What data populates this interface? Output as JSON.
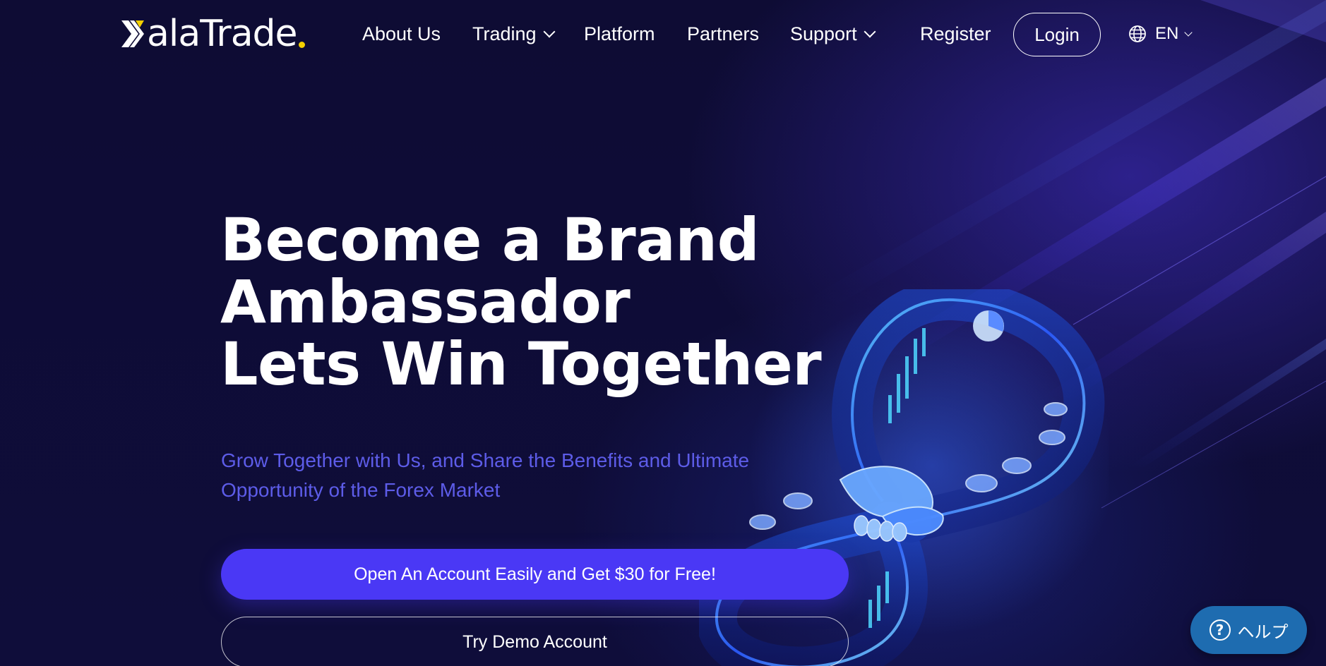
{
  "brand": {
    "name_part1": "ala",
    "name_part2": "Trade",
    "accent_yellow": "#f5d000",
    "primary_purple": "#4a38f5",
    "subtitle_color": "#5d5ce8",
    "background": "#0d0b33"
  },
  "nav": {
    "items": [
      {
        "label": "About Us",
        "has_dropdown": false
      },
      {
        "label": "Trading",
        "has_dropdown": true
      },
      {
        "label": "Platform",
        "has_dropdown": false
      },
      {
        "label": "Partners",
        "has_dropdown": false
      },
      {
        "label": "Support",
        "has_dropdown": true
      }
    ],
    "register_label": "Register",
    "login_label": "Login",
    "language_label": "EN",
    "language_icon": "globe-icon"
  },
  "hero": {
    "title_lines": [
      "Become a Brand",
      "Ambassador",
      "Lets Win Together"
    ],
    "subtitle": "Grow Together with Us, and Share the Benefits and Ultimate Opportunity of the Forex Market",
    "primary_cta": "Open An Account Easily and Get $30 for Free!",
    "secondary_cta": "Try Demo Account",
    "illustration": "infinity-handshake-illustration"
  },
  "help_widget": {
    "label": "ヘルプ",
    "icon": "question-mark-icon"
  }
}
